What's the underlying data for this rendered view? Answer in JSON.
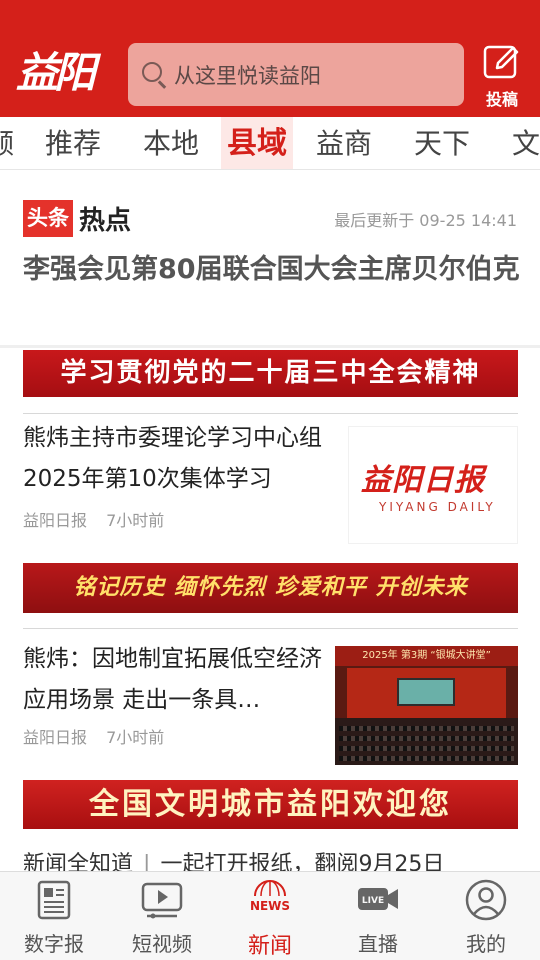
{
  "header": {
    "logo": "益阳",
    "search_placeholder": "从这里悦读益阳",
    "submit_label": "投稿"
  },
  "tabs": [
    {
      "label": "频"
    },
    {
      "label": "推荐"
    },
    {
      "label": "本地"
    },
    {
      "label": "县域",
      "active": true
    },
    {
      "label": "益商"
    },
    {
      "label": "天下"
    },
    {
      "label": "文"
    }
  ],
  "headline": {
    "badge": "头条",
    "hot": "热点",
    "updated": "最后更新于 09-25 14:41",
    "title": "李强会见第80届联合国大会主席贝尔伯克"
  },
  "banners": [
    "学习贯彻党的二十届三中全会精神",
    "铭记历史  缅怀先烈  珍爱和平  开创未来",
    "全国文明城市益阳欢迎您"
  ],
  "articles": [
    {
      "title": "熊炜主持市委理论学习中心组2025年第10次集体学习",
      "source": "益阳日报",
      "time": "7小时前",
      "thumb_title": "益阳日报",
      "thumb_sub": "YIYANG DAILY"
    },
    {
      "title": "熊炜：因地制宜拓展低空经济应用场景 走出一条具…",
      "source": "益阳日报",
      "time": "7小时前",
      "thumb_caption": "2025年 第3期 “银城大讲堂”"
    }
  ],
  "ticker": {
    "label": "新闻全知道",
    "text": "一起打开报纸，翻阅9月25日"
  },
  "bottom_nav": [
    {
      "label": "数字报",
      "icon": "newspaper-icon"
    },
    {
      "label": "短视频",
      "icon": "video-icon"
    },
    {
      "label": "新闻",
      "icon": "news-globe-icon",
      "active": true,
      "icon_text": "NEWS"
    },
    {
      "label": "直播",
      "icon": "live-camera-icon",
      "icon_text": "LIVE"
    },
    {
      "label": "我的",
      "icon": "user-icon"
    }
  ],
  "colors": {
    "brand_red": "#d4201a",
    "search_bg": "#eda49c"
  }
}
